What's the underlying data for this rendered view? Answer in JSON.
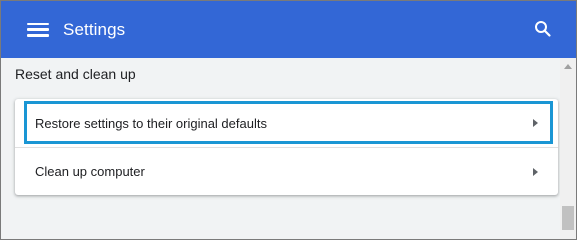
{
  "header": {
    "title": "Settings",
    "menu_icon": "hamburger-menu-icon",
    "search_icon": "search-icon",
    "bg_color": "#3367d6"
  },
  "section": {
    "title": "Reset and clean up",
    "items": [
      {
        "label": "Restore settings to their original defaults",
        "highlighted": true,
        "icon": "chevron-right-icon"
      },
      {
        "label": "Clean up computer",
        "highlighted": false,
        "icon": "chevron-right-icon"
      }
    ],
    "highlight_color": "#1a96d4"
  }
}
